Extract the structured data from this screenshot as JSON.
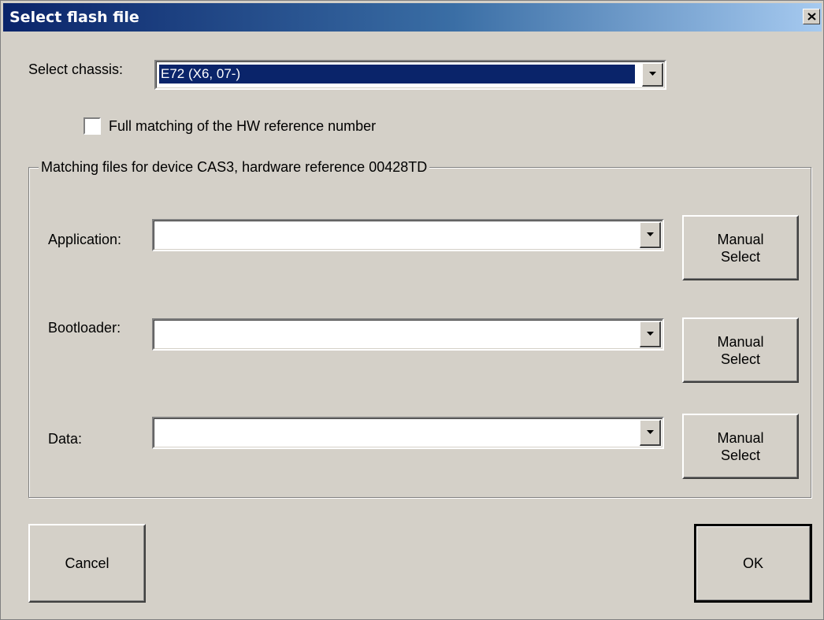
{
  "window": {
    "title": "Select flash file",
    "close_label": "×"
  },
  "chassis": {
    "label": "Select chassis:",
    "value": "E72 (X6, 07-)"
  },
  "full_matching": {
    "label": "Full matching of the HW reference number",
    "checked": false
  },
  "group": {
    "legend": "Matching files for device CAS3, hardware reference 00428TD"
  },
  "rows": [
    {
      "label": "Application:",
      "value": "",
      "button": "Manual\nSelect"
    },
    {
      "label": "Bootloader:",
      "value": "",
      "button": "Manual\nSelect"
    },
    {
      "label": "Data:",
      "value": "",
      "button": "Manual\nSelect"
    }
  ],
  "footer": {
    "cancel_label": "Cancel",
    "ok_label": "OK"
  },
  "colors": {
    "face": "#d4d0c8",
    "title_start": "#0a246a",
    "title_end": "#a6caf0",
    "selection": "#0a246a"
  },
  "icons": {
    "close": "close-icon",
    "dropdown": "chevron-down-icon"
  }
}
